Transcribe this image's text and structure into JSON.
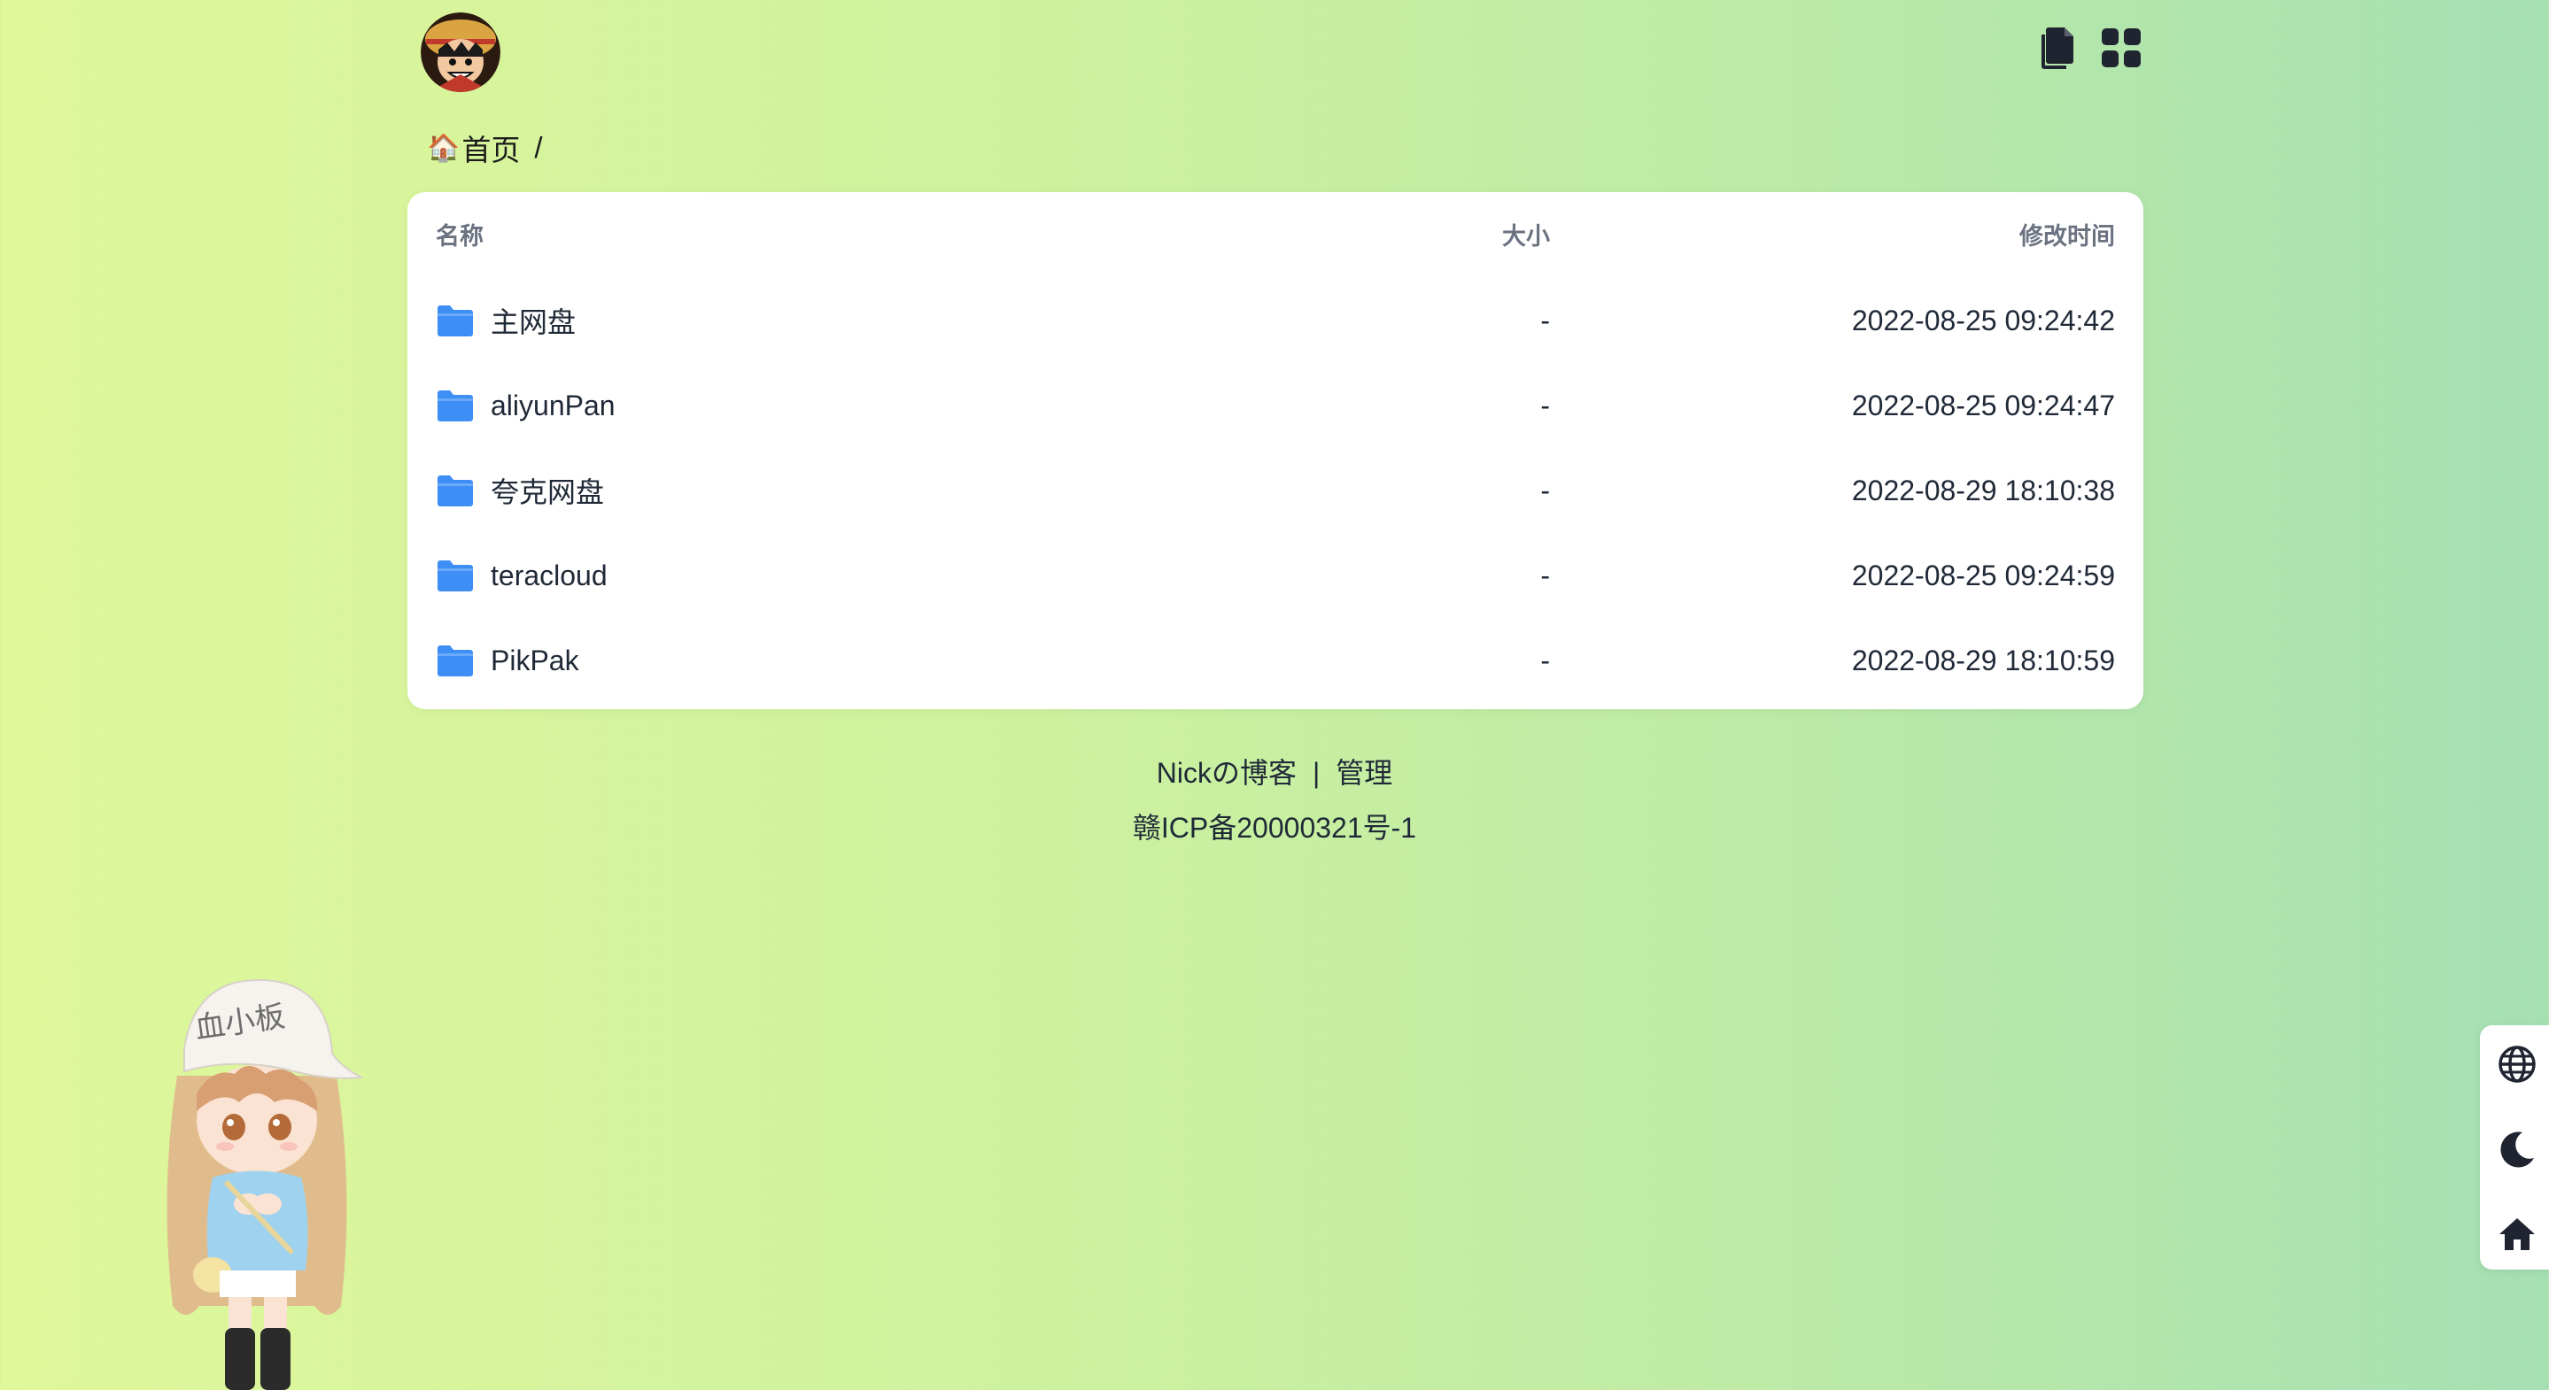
{
  "header": {
    "avatar_alt": "avatar",
    "icons": [
      "copy-icon",
      "grid-icon"
    ]
  },
  "breadcrumb": {
    "home_icon": "🏠",
    "home_label": "首页",
    "separator": "/"
  },
  "table": {
    "columns": {
      "name": "名称",
      "size": "大小",
      "modified": "修改时间"
    },
    "rows": [
      {
        "name": "主网盘",
        "size": "-",
        "modified": "2022-08-25 09:24:42"
      },
      {
        "name": "aliyunPan",
        "size": "-",
        "modified": "2022-08-25 09:24:47"
      },
      {
        "name": "夸克网盘",
        "size": "-",
        "modified": "2022-08-29 18:10:38"
      },
      {
        "name": "teracloud",
        "size": "-",
        "modified": "2022-08-25 09:24:59"
      },
      {
        "name": "PikPak",
        "size": "-",
        "modified": "2022-08-29 18:10:59"
      }
    ]
  },
  "footer": {
    "blog_link": "Nickの博客",
    "divider": "|",
    "admin_link": "管理",
    "icp": "赣ICP备20000321号-1"
  },
  "mascot": {
    "hat_text": "血小板"
  },
  "side_tools": [
    "globe-icon",
    "moon-icon",
    "home-icon"
  ],
  "colors": {
    "folder": "#3d8ef5",
    "bg_start": "#e0f79a",
    "bg_end": "#a5e0b3",
    "card": "#ffffff"
  }
}
